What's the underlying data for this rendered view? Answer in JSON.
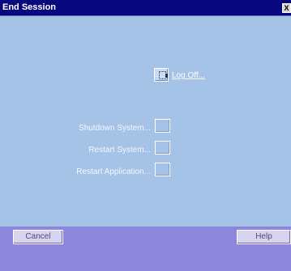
{
  "window": {
    "title": "End Session",
    "close_glyph": "X"
  },
  "logoff": {
    "label": "Log Off..."
  },
  "options": [
    {
      "label": "Shutdown System...",
      "mnemonic": "S"
    },
    {
      "label": "Restart System...",
      "mnemonic": "R"
    },
    {
      "label": "Restart Application...",
      "mnemonic": "A"
    }
  ],
  "footer": {
    "cancel_label": "Cancel",
    "help_label": "Help"
  },
  "colors": {
    "titlebar": "#07077e",
    "client": "#a4c3e6",
    "footer": "#8c87dd"
  },
  "icons": [
    "logoff-icon"
  ]
}
